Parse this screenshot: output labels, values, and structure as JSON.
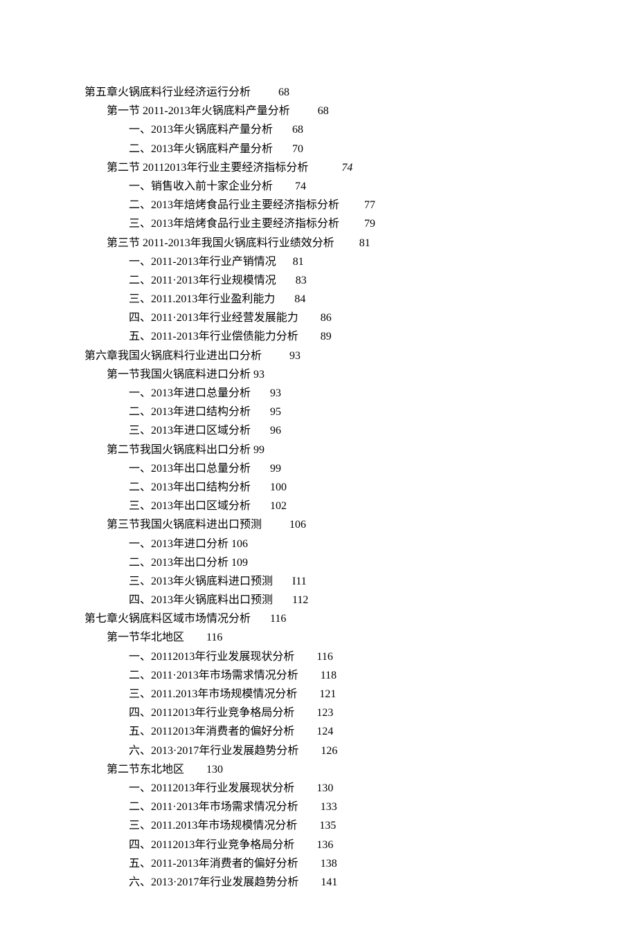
{
  "toc": [
    {
      "indent": 0,
      "text": "第五章火锅底料行业经济运行分析",
      "gap": "          ",
      "page": "68"
    },
    {
      "indent": 1,
      "text": "第一节 2011-2013年火锅底料产量分析",
      "gap": "          ",
      "page": "68"
    },
    {
      "indent": 2,
      "text": "一、2013年火锅底料产量分析",
      "gap": "       ",
      "page": "68"
    },
    {
      "indent": 2,
      "text": "二、2013年火锅底料产量分析",
      "gap": "       ",
      "page": "70"
    },
    {
      "indent": 1,
      "text": "第二节 20112013年行业主要经济指标分析",
      "gap": "            ",
      "page": "74",
      "italicPage": true
    },
    {
      "indent": 2,
      "text": "一、销售收入前十家企业分析",
      "gap": "        ",
      "page": "74"
    },
    {
      "indent": 2,
      "text": "二、2013年焙烤食品行业主要经济指标分析",
      "gap": "         ",
      "page": "77"
    },
    {
      "indent": 2,
      "text": "三、2013年焙烤食品行业主要经济指标分析",
      "gap": "         ",
      "page": "79"
    },
    {
      "indent": 1,
      "text": "第三节 2011-2013年我国火锅底料行业绩效分析",
      "gap": "         ",
      "page": "81"
    },
    {
      "indent": 2,
      "text": "一、2011-2013年行业产销情况",
      "gap": "      ",
      "page": "81"
    },
    {
      "indent": 2,
      "text": "二、2011·2013年行业规模情况",
      "gap": "       ",
      "page": "83"
    },
    {
      "indent": 2,
      "text": "三、2011.2013年行业盈利能力",
      "gap": "       ",
      "page": "84"
    },
    {
      "indent": 2,
      "text": "四、2011·2013年行业经营发展能力",
      "gap": "        ",
      "page": "86"
    },
    {
      "indent": 2,
      "text": "五、2011-2013年行业偿债能力分析",
      "gap": "        ",
      "page": "89"
    },
    {
      "indent": 0,
      "text": "第六章我国火锅底料行业进出口分析",
      "gap": "          ",
      "page": "93"
    },
    {
      "indent": 1,
      "text": "第一节我国火锅底料进口分析 93",
      "gap": "",
      "page": ""
    },
    {
      "indent": 2,
      "text": "一、2013年进口总量分析",
      "gap": "       ",
      "page": "93"
    },
    {
      "indent": 2,
      "text": "二、2013年进口结构分析",
      "gap": "       ",
      "page": "95"
    },
    {
      "indent": 2,
      "text": "三、2013年进口区域分析",
      "gap": "       ",
      "page": "96"
    },
    {
      "indent": 1,
      "text": "第二节我国火锅底料出口分析 99",
      "gap": "",
      "page": ""
    },
    {
      "indent": 2,
      "text": "一、2013年出口总量分析",
      "gap": "       ",
      "page": "99"
    },
    {
      "indent": 2,
      "text": "二、2013年出口结构分析",
      "gap": "       ",
      "page": "100"
    },
    {
      "indent": 2,
      "text": "三、2013年出口区域分析",
      "gap": "       ",
      "page": "102"
    },
    {
      "indent": 1,
      "text": "第三节我国火锅底料进出口预测",
      "gap": "          ",
      "page": "106"
    },
    {
      "indent": 2,
      "text": "一、2013年进口分析 106",
      "gap": "",
      "page": ""
    },
    {
      "indent": 2,
      "text": "二、2013年出口分析 109",
      "gap": "",
      "page": ""
    },
    {
      "indent": 2,
      "text": "三、2013年火锅底料进口预测",
      "gap": "       ",
      "page": "I11"
    },
    {
      "indent": 2,
      "text": "四、2013年火锅底料出口预测",
      "gap": "       ",
      "page": "112"
    },
    {
      "indent": 0,
      "text": "第七章火锅底料区域市场情况分析",
      "gap": "       ",
      "page": "116"
    },
    {
      "indent": 1,
      "text": "第一节华北地区",
      "gap": "        ",
      "page": "116"
    },
    {
      "indent": 2,
      "text": "一、20112013年行业发展现状分析",
      "gap": "        ",
      "page": "116"
    },
    {
      "indent": 2,
      "text": "二、2011·2013年市场需求情况分析",
      "gap": "        ",
      "page": "118"
    },
    {
      "indent": 2,
      "text": "三、2011.2013年市场规模情况分析",
      "gap": "        ",
      "page": "121"
    },
    {
      "indent": 2,
      "text": "四、20112013年行业竞争格局分析",
      "gap": "        ",
      "page": "123"
    },
    {
      "indent": 2,
      "text": "五、20112013年消费者的偏好分析",
      "gap": "        ",
      "page": "124"
    },
    {
      "indent": 2,
      "text": "六、2013·2017年行业发展趋势分析",
      "gap": "        ",
      "page": "126"
    },
    {
      "indent": 1,
      "text": "第二节东北地区",
      "gap": "        ",
      "page": "130"
    },
    {
      "indent": 2,
      "text": "一、20112013年行业发展现状分析",
      "gap": "        ",
      "page": "130"
    },
    {
      "indent": 2,
      "text": "二、2011·2013年市场需求情况分析",
      "gap": "        ",
      "page": "133"
    },
    {
      "indent": 2,
      "text": "三、2011.2013年市场规模情况分析",
      "gap": "        ",
      "page": "135"
    },
    {
      "indent": 2,
      "text": "四、20112013年行业竞争格局分析",
      "gap": "        ",
      "page": "136"
    },
    {
      "indent": 2,
      "text": "五、2011-2013年消费者的偏好分析",
      "gap": "        ",
      "page": "138"
    },
    {
      "indent": 2,
      "text": "六、2013·2017年行业发展趋势分析",
      "gap": "        ",
      "page": "141"
    }
  ]
}
